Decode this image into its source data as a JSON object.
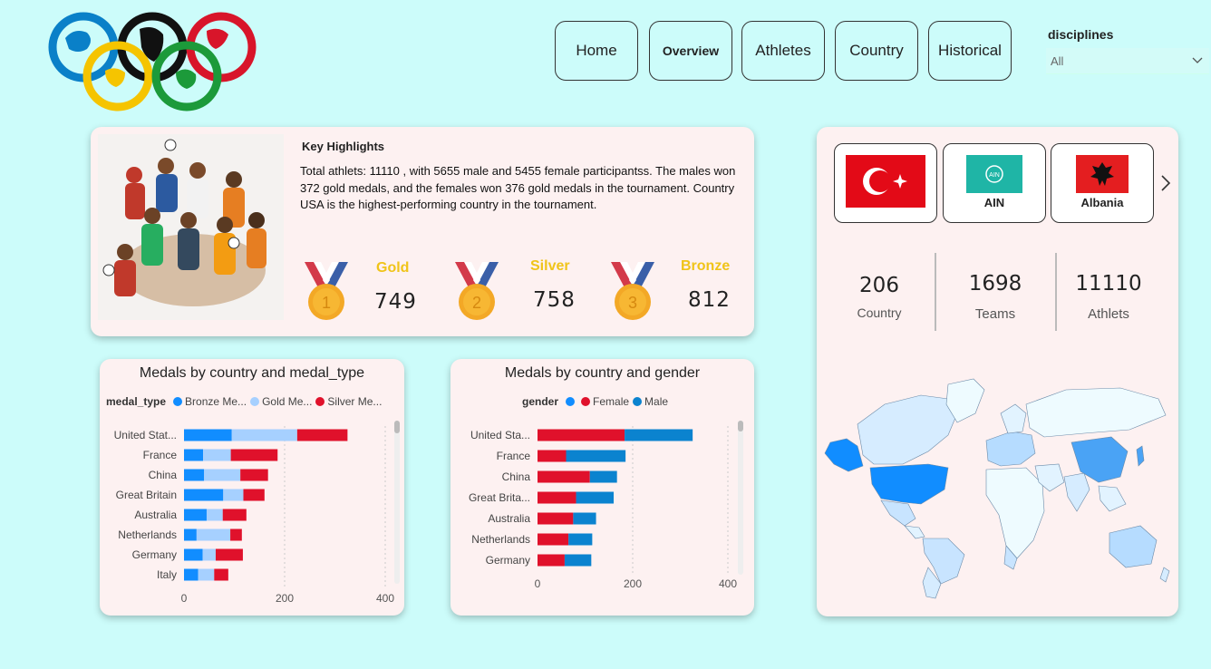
{
  "nav": {
    "items": [
      {
        "label": "Home",
        "active": false
      },
      {
        "label": "Overview",
        "active": true
      },
      {
        "label": "Athletes",
        "active": false
      },
      {
        "label": "Country",
        "active": false
      },
      {
        "label": "Historical",
        "active": false
      }
    ]
  },
  "filter": {
    "label": "disciplines",
    "value": "All"
  },
  "highlights": {
    "title": "Key Highlights",
    "text": "Total athlets: 11110 , with 5655 male and 5455 female participantss. The males won 372 gold medals, and the females won 376 gold medals in the tournament. Country USA is the highest-performing country in the tournament.",
    "medals": [
      {
        "label": "Gold",
        "value": "749",
        "number": "1"
      },
      {
        "label": "Silver",
        "value": "758",
        "number": "2"
      },
      {
        "label": "Bronze",
        "value": "812",
        "number": "3"
      }
    ]
  },
  "flags": [
    {
      "name": "",
      "icon": "turkey-flag-icon"
    },
    {
      "name": "AIN",
      "icon": "ain-flag-icon"
    },
    {
      "name": "Albania",
      "icon": "albania-flag-icon"
    }
  ],
  "kpis": [
    {
      "value": "206",
      "label": "Country"
    },
    {
      "value": "1698",
      "label": "Teams"
    },
    {
      "value": "11110",
      "label": "Athlets"
    }
  ],
  "colors": {
    "bronze": "#118dff",
    "gold": "#a6d0ff",
    "silver": "#e0112b",
    "male": "#0b83cf",
    "female": "#e0112b",
    "medal_text": "#f0c419"
  },
  "chart_data": [
    {
      "type": "bar",
      "orientation": "horizontal-stacked",
      "title": "Medals by country and medal_type",
      "legend_title": "medal_type",
      "legend_position": "top",
      "categories": [
        "United Stat...",
        "France",
        "China",
        "Great Britain",
        "Australia",
        "Netherlands",
        "Germany",
        "Italy"
      ],
      "series": [
        {
          "name": "Bronze Me...",
          "values": [
            95,
            38,
            40,
            78,
            45,
            25,
            37,
            28
          ]
        },
        {
          "name": "Gold Me...",
          "values": [
            130,
            55,
            72,
            40,
            32,
            67,
            26,
            32
          ]
        },
        {
          "name": "Silver Me...",
          "values": [
            100,
            93,
            55,
            42,
            47,
            23,
            54,
            28
          ]
        }
      ],
      "xticks": [
        "0",
        "200",
        "400"
      ],
      "xlim": [
        0,
        400
      ]
    },
    {
      "type": "bar",
      "orientation": "horizontal-stacked",
      "title": "Medals by country and gender",
      "legend_title": "gender",
      "legend_position": "top",
      "categories": [
        "United Sta...",
        "France",
        "China",
        "Great Brita...",
        "Australia",
        "Netherlands",
        "Germany"
      ],
      "series": [
        {
          "name": "Female",
          "values": [
            183,
            60,
            110,
            81,
            75,
            65,
            57
          ]
        },
        {
          "name": "Male",
          "values": [
            143,
            125,
            57,
            79,
            48,
            50,
            56
          ]
        }
      ],
      "xticks": [
        "0",
        "200",
        "400"
      ],
      "xlim": [
        0,
        400
      ]
    }
  ]
}
